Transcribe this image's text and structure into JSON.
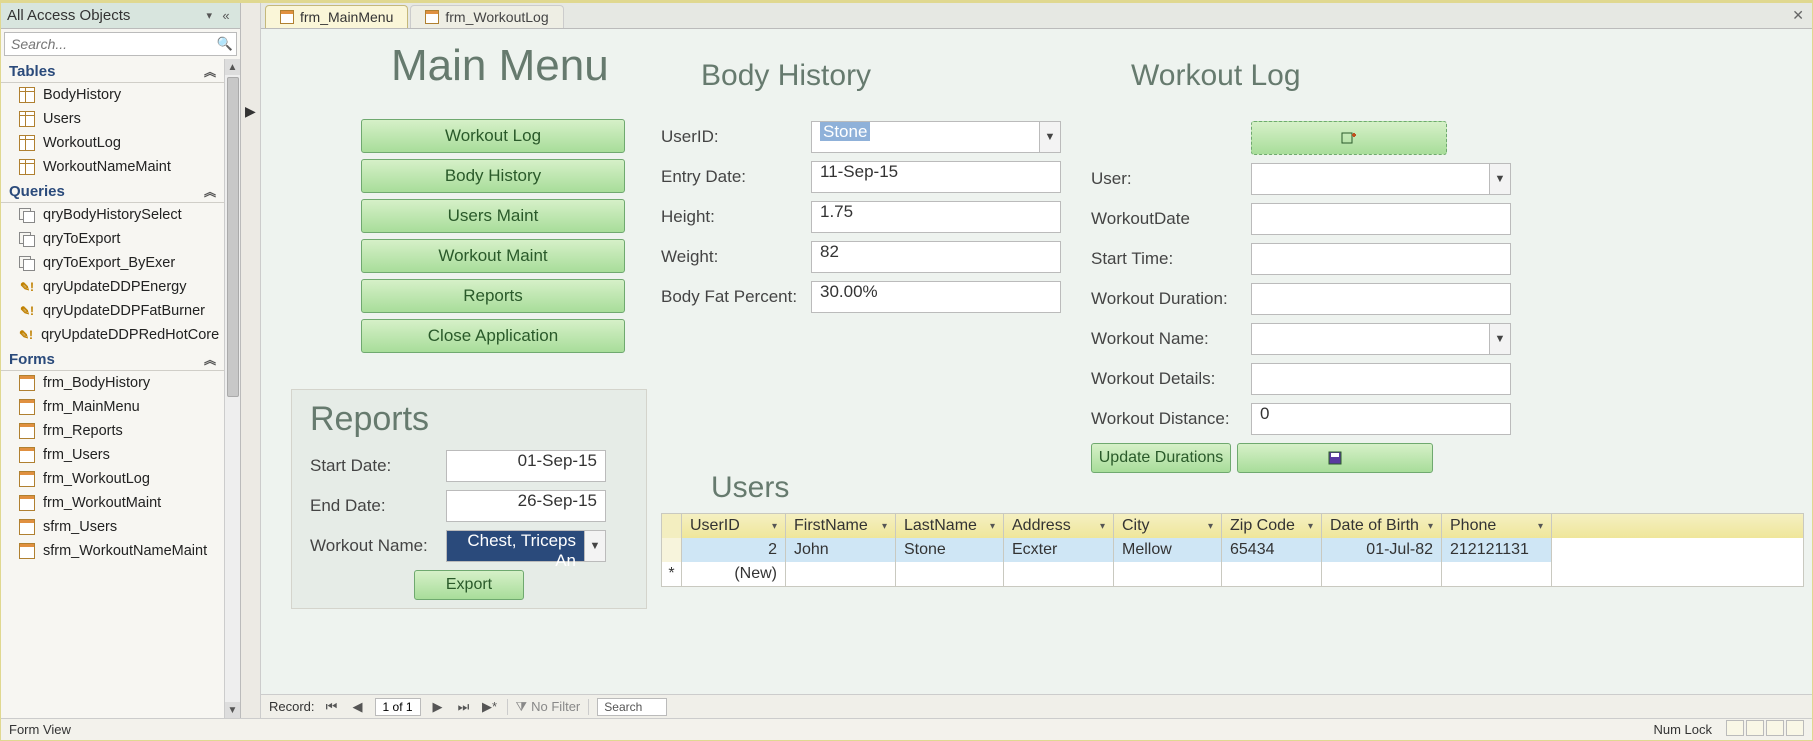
{
  "nav": {
    "header": "All Access Objects",
    "search_placeholder": "Search...",
    "groups": {
      "tables": {
        "label": "Tables",
        "items": [
          "BodyHistory",
          "Users",
          "WorkoutLog",
          "WorkoutNameMaint"
        ]
      },
      "queries": {
        "label": "Queries",
        "items": [
          "qryBodyHistorySelect",
          "qryToExport",
          "qryToExport_ByExer",
          "qryUpdateDDPEnergy",
          "qryUpdateDDPFatBurner",
          "qryUpdateDDPRedHotCore"
        ]
      },
      "forms": {
        "label": "Forms",
        "items": [
          "frm_BodyHistory",
          "frm_MainMenu",
          "frm_Reports",
          "frm_Users",
          "frm_WorkoutLog",
          "frm_WorkoutMaint",
          "sfrm_Users",
          "sfrm_WorkoutNameMaint"
        ]
      }
    }
  },
  "tabs": {
    "active": "frm_MainMenu",
    "other": "frm_WorkoutLog"
  },
  "mainmenu": {
    "title": "Main Menu",
    "buttons": [
      "Workout Log",
      "Body History",
      "Users Maint",
      "Workout Maint",
      "Reports",
      "Close Application"
    ]
  },
  "bodyhistory": {
    "title": "Body History",
    "labels": {
      "userid": "UserID:",
      "entrydate": "Entry Date:",
      "height": "Height:",
      "weight": "Weight:",
      "bodyfat": "Body Fat Percent:"
    },
    "values": {
      "userid": "Stone",
      "entrydate": "11-Sep-15",
      "height": "1.75",
      "weight": "82",
      "bodyfat": "30.00%"
    }
  },
  "workoutlog": {
    "title": "Workout Log",
    "labels": {
      "user": "User:",
      "date": "WorkoutDate",
      "start": "Start Time:",
      "duration": "Workout Duration:",
      "name": "Workout Name:",
      "details": "Workout Details:",
      "distance": "Workout Distance:"
    },
    "values": {
      "user": "",
      "date": "",
      "start": "",
      "duration": "",
      "name": "",
      "details": "",
      "distance": "0"
    },
    "update_btn": "Update Durations"
  },
  "reports": {
    "title": "Reports",
    "labels": {
      "start": "Start Date:",
      "end": "End Date:",
      "name": "Workout Name:"
    },
    "values": {
      "start": "01-Sep-15",
      "end": "26-Sep-15",
      "name": "Chest, Triceps An"
    },
    "export_btn": "Export"
  },
  "users": {
    "title": "Users",
    "columns": [
      "UserID",
      "FirstName",
      "LastName",
      "Address",
      "City",
      "Zip Code",
      "Date of Birth",
      "Phone"
    ],
    "row": {
      "UserID": "2",
      "FirstName": "John",
      "LastName": "Stone",
      "Address": "Ecxter",
      "City": "Mellow",
      "Zip Code": "65434",
      "Date of Birth": "01-Jul-82",
      "Phone": "212121131"
    },
    "newrow_label": "(New)"
  },
  "recordnav": {
    "label": "Record:",
    "pos": "1 of 1",
    "filter": "No Filter",
    "search": "Search"
  },
  "status": {
    "left": "Form View",
    "numlock": "Num Lock"
  }
}
